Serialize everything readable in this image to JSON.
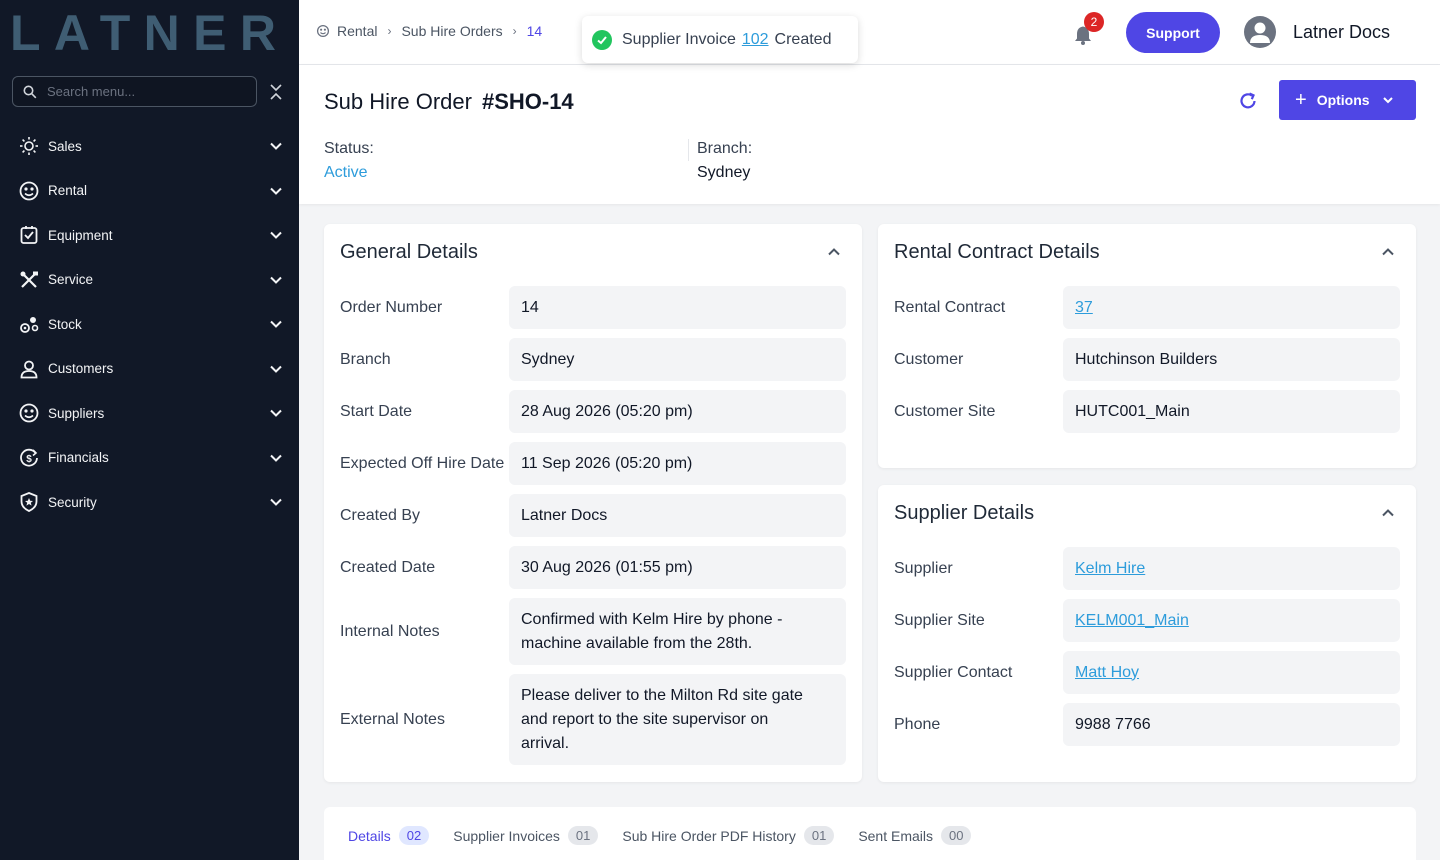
{
  "brand": {
    "logo_text": "LATNER",
    "logo_color": "#3f5d73",
    "accent": "#4f46e5",
    "link": "#2d9cdb"
  },
  "sidebar": {
    "search_placeholder": "Search menu...",
    "items": [
      {
        "label": "Sales",
        "icon": "sales-icon"
      },
      {
        "label": "Rental",
        "icon": "rental-icon"
      },
      {
        "label": "Equipment",
        "icon": "equipment-icon"
      },
      {
        "label": "Service",
        "icon": "service-icon"
      },
      {
        "label": "Stock",
        "icon": "stock-icon"
      },
      {
        "label": "Customers",
        "icon": "customers-icon"
      },
      {
        "label": "Suppliers",
        "icon": "suppliers-icon"
      },
      {
        "label": "Financials",
        "icon": "financials-icon"
      },
      {
        "label": "Security",
        "icon": "security-icon"
      }
    ]
  },
  "header": {
    "breadcrumb": [
      "Rental",
      "Sub Hire Orders",
      "14"
    ],
    "toast": {
      "prefix": "Supplier Invoice",
      "link": "102",
      "suffix": "Created"
    },
    "notifications_count": "2",
    "support_label": "Support",
    "user_name": "Latner Docs"
  },
  "page": {
    "title": "Sub Hire Order",
    "code": "#SHO-14",
    "options_label": "Options",
    "status_label": "Status:",
    "status_value": "Active",
    "branch_label": "Branch:",
    "branch_value": "Sydney"
  },
  "general": {
    "title": "General Details",
    "fields": [
      {
        "label": "Order Number",
        "value": "14"
      },
      {
        "label": "Branch",
        "value": "Sydney"
      },
      {
        "label": "Start Date",
        "value": "28 Aug 2026 (05:20 pm)"
      },
      {
        "label": "Expected Off Hire Date",
        "value": "11 Sep 2026 (05:20 pm)"
      },
      {
        "label": "Created By",
        "value": "Latner Docs"
      },
      {
        "label": "Created Date",
        "value": "30 Aug 2026 (01:55 pm)"
      },
      {
        "label": "Internal Notes",
        "value": "Confirmed with Kelm Hire by phone - machine available from the 28th."
      },
      {
        "label": "External Notes",
        "value": "Please deliver to the Milton Rd site gate and report to the site supervisor on arrival."
      }
    ]
  },
  "contract": {
    "title": "Rental Contract Details",
    "fields": [
      {
        "label": "Rental Contract",
        "value": "37"
      },
      {
        "label": "Customer",
        "value": "Hutchinson Builders"
      },
      {
        "label": "Customer Site",
        "value": "HUTC001_Main"
      }
    ]
  },
  "supplier": {
    "title": "Supplier Details",
    "fields": [
      {
        "label": "Supplier",
        "value": "Kelm Hire"
      },
      {
        "label": "Supplier Site",
        "value": "KELM001_Main"
      },
      {
        "label": "Supplier Contact",
        "value": "Matt Hoy"
      },
      {
        "label": "Phone",
        "value": "9988 7766"
      }
    ]
  },
  "tabs": [
    {
      "label": "Details",
      "count": "02"
    },
    {
      "label": "Supplier Invoices",
      "count": "01"
    },
    {
      "label": "Sub Hire Order PDF History",
      "count": "01"
    },
    {
      "label": "Sent Emails",
      "count": "00"
    }
  ]
}
